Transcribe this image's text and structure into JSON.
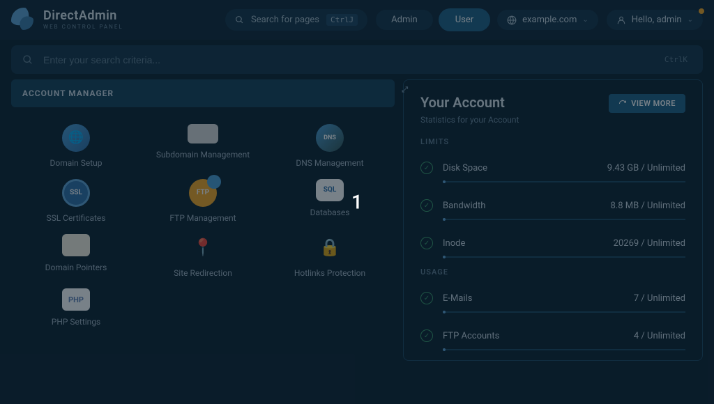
{
  "brand": {
    "title": "DirectAdmin",
    "subtitle": "WEB CONTROL PANEL"
  },
  "header": {
    "search_pages": "Search for pages",
    "search_kbd": "CtrlJ",
    "tab_admin": "Admin",
    "tab_user": "User",
    "domain": "example.com",
    "hello": "Hello, admin"
  },
  "searchbar": {
    "placeholder": "Enter your search criteria...",
    "kbd": "CtrlK"
  },
  "account_manager": {
    "title": "ACCOUNT MANAGER",
    "items": [
      "Domain Setup",
      "Subdomain Management",
      "DNS Management",
      "SSL Certificates",
      "FTP Management",
      "Databases",
      "Domain Pointers",
      "Site Redirection",
      "Hotlinks Protection",
      "PHP Settings"
    ]
  },
  "account_card": {
    "title": "Your Account",
    "subtitle": "Statistics for your Account",
    "button": "VIEW MORE",
    "limits_label": "LIMITS",
    "usage_label": "USAGE",
    "limits": [
      {
        "name": "Disk Space",
        "value": "9.43 GB / Unlimited"
      },
      {
        "name": "Bandwidth",
        "value": "8.8 MB / Unlimited"
      },
      {
        "name": "Inode",
        "value": "20269 / Unlimited"
      }
    ],
    "usage": [
      {
        "name": "E-Mails",
        "value": "7 / Unlimited"
      },
      {
        "name": "FTP Accounts",
        "value": "4 / Unlimited"
      }
    ]
  },
  "overlay": {
    "lightbox_label": "1"
  },
  "icon_text": {
    "dns": "DNS",
    "ssl": "SSL",
    "ftp": "FTP",
    "sql": "SQL",
    "php": "PHP"
  }
}
